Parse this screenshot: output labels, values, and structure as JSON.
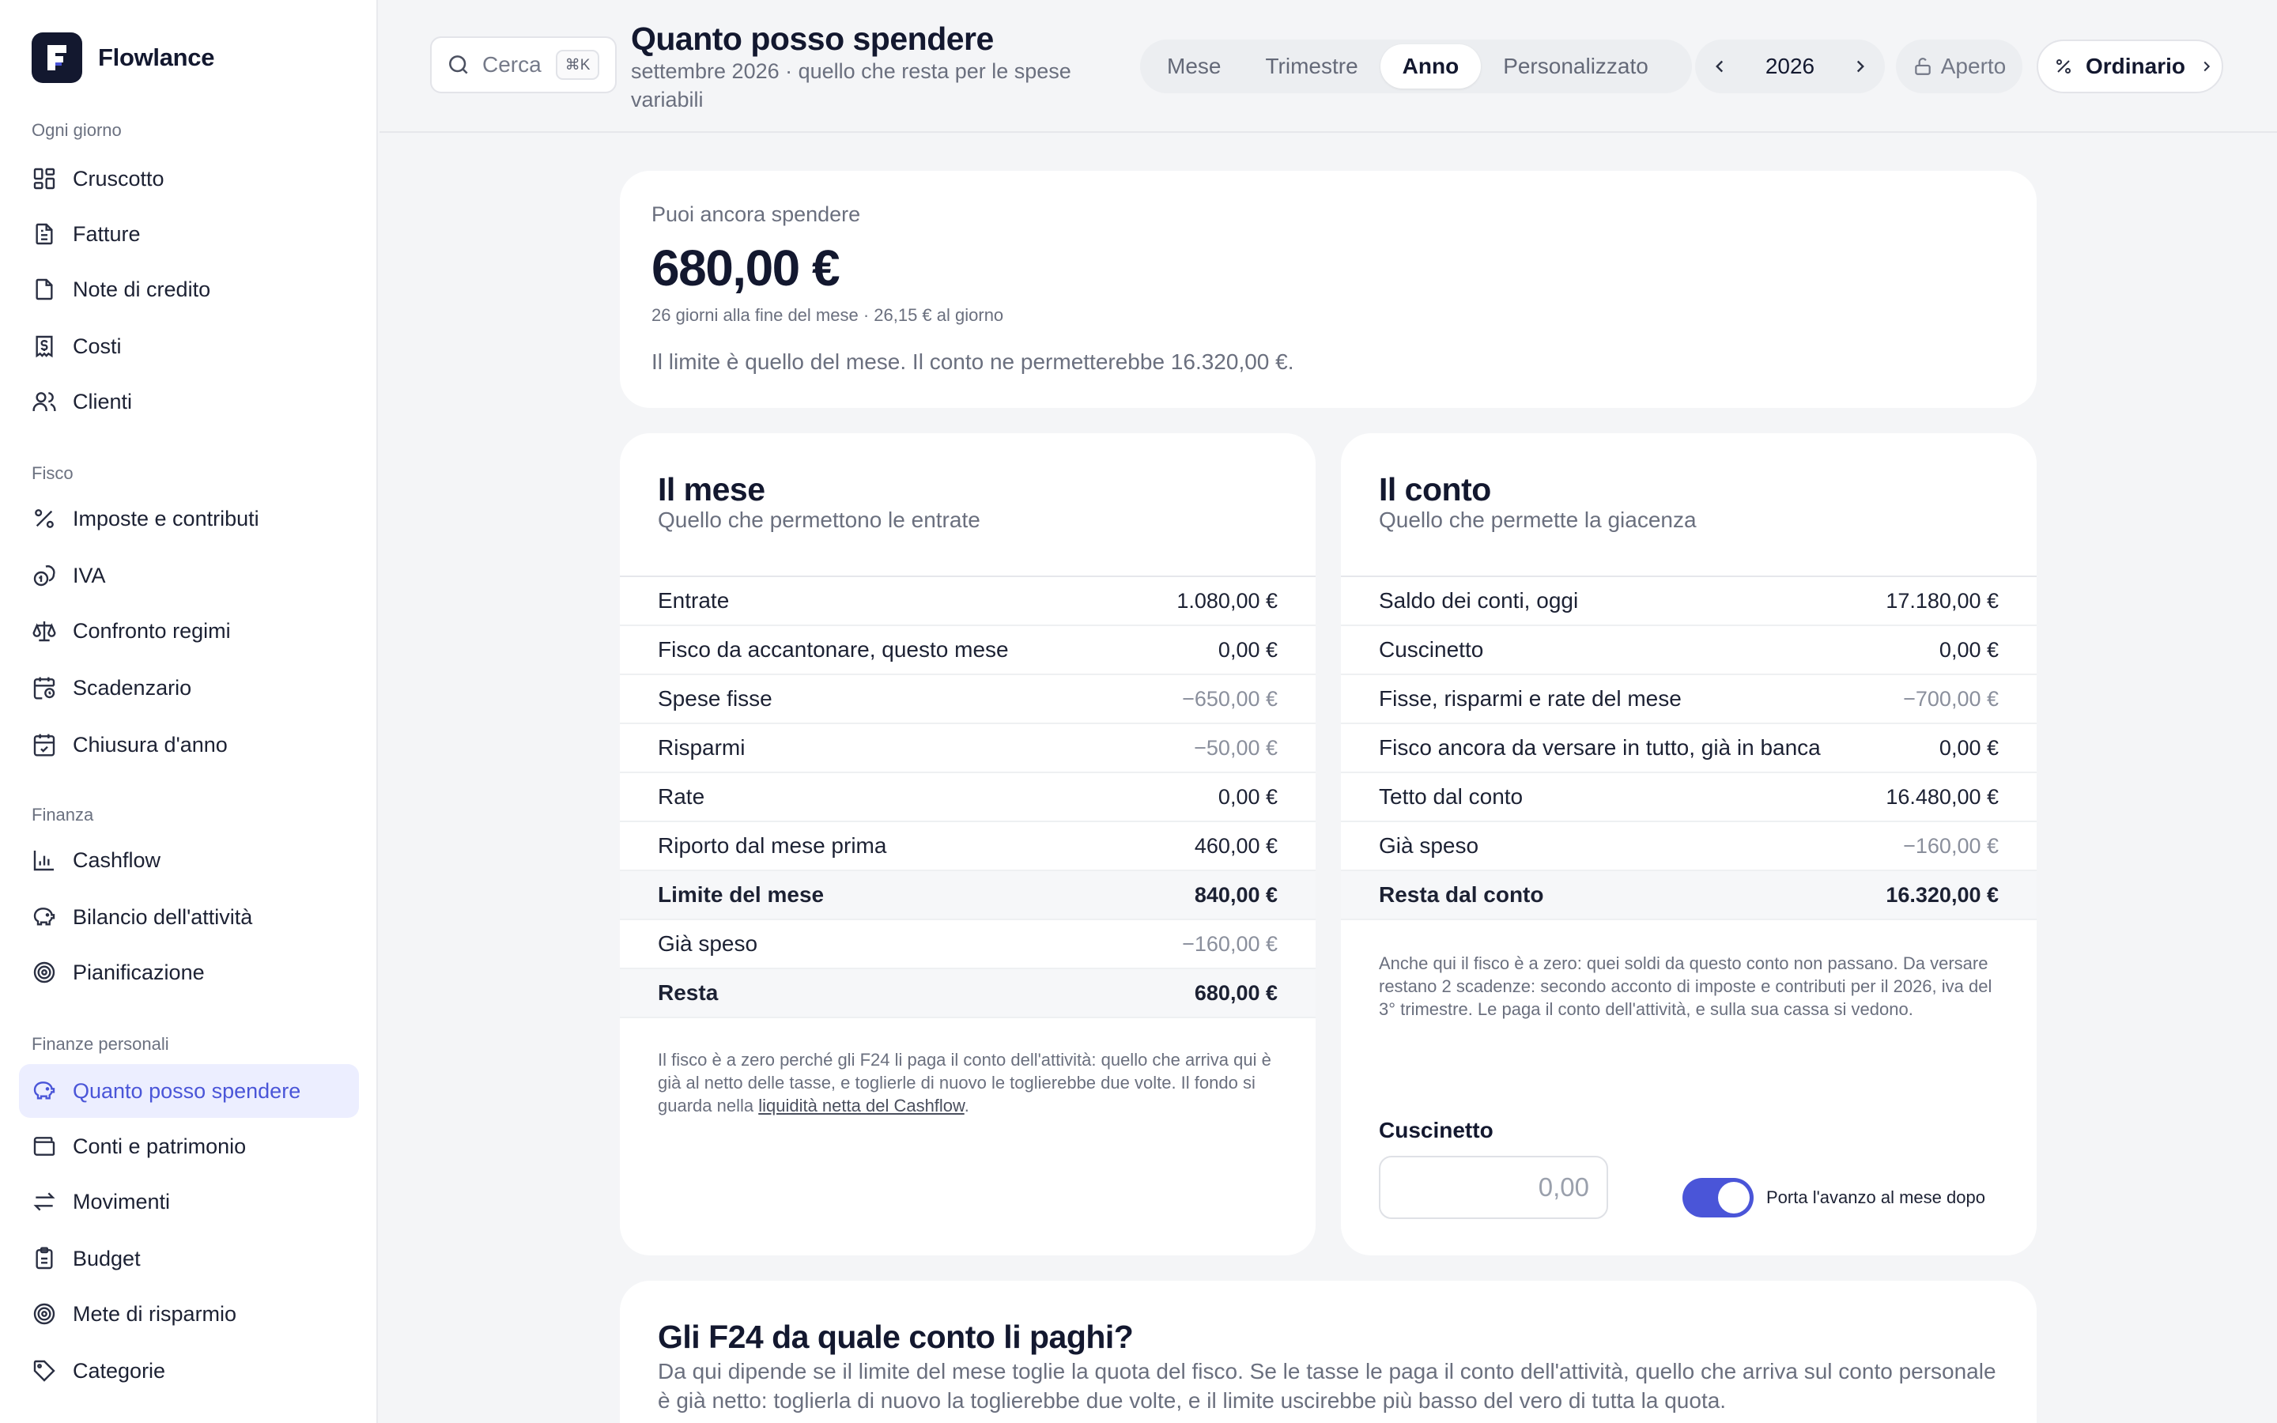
{
  "app": {
    "name": "Flowlance"
  },
  "sidebar": {
    "sections": [
      {
        "title": "Ogni giorno",
        "items": [
          {
            "label": "Cruscotto",
            "icon": "dashboard-icon"
          },
          {
            "label": "Fatture",
            "icon": "invoice-icon"
          },
          {
            "label": "Note di credito",
            "icon": "credit-note-icon"
          },
          {
            "label": "Costi",
            "icon": "receipt-icon"
          },
          {
            "label": "Clienti",
            "icon": "users-icon"
          }
        ]
      },
      {
        "title": "Fisco",
        "items": [
          {
            "label": "Imposte e contributi",
            "icon": "percent-icon"
          },
          {
            "label": "IVA",
            "icon": "coins-icon"
          },
          {
            "label": "Confronto regimi",
            "icon": "scale-icon"
          },
          {
            "label": "Scadenzario",
            "icon": "calendar-clock-icon"
          },
          {
            "label": "Chiusura d'anno",
            "icon": "calendar-check-icon"
          }
        ]
      },
      {
        "title": "Finanza",
        "items": [
          {
            "label": "Cashflow",
            "icon": "bar-chart-icon"
          },
          {
            "label": "Bilancio dell'attività",
            "icon": "piggy-bank-icon"
          },
          {
            "label": "Pianificazione",
            "icon": "target-icon"
          }
        ]
      },
      {
        "title": "Finanze personali",
        "items": [
          {
            "label": "Quanto posso spendere",
            "icon": "piggy-bank-icon",
            "active": true
          },
          {
            "label": "Conti e patrimonio",
            "icon": "wallet-icon"
          },
          {
            "label": "Movimenti",
            "icon": "arrows-swap-icon"
          },
          {
            "label": "Budget",
            "icon": "clipboard-icon"
          },
          {
            "label": "Mete di risparmio",
            "icon": "target-icon"
          },
          {
            "label": "Categorie",
            "icon": "tag-icon"
          }
        ]
      }
    ]
  },
  "topbar": {
    "search_label": "Cerca",
    "search_shortcut": "⌘K",
    "title": "Quanto posso spendere",
    "subtitle": "settembre 2026 · quello che resta per le spese variabili",
    "period_tabs": [
      "Mese",
      "Trimestre",
      "Anno",
      "Personalizzato"
    ],
    "active_period": "Anno",
    "year": "2026",
    "lock_label": "Aperto",
    "regime_label": "Ordinario"
  },
  "summary": {
    "label": "Puoi ancora spendere",
    "amount": "680,00 €",
    "meta": "26 giorni alla fine del mese · 26,15 € al giorno",
    "note": "Il limite è quello del mese. Il conto ne permetterebbe 16.320,00 €."
  },
  "month_card": {
    "title": "Il mese",
    "subtitle": "Quello che permettono le entrate",
    "rows": [
      {
        "label": "Entrate",
        "value": "1.080,00 €"
      },
      {
        "label": "Fisco da accantonare, questo mese",
        "value": "0,00 €"
      },
      {
        "label": "Spese fisse",
        "value": "−650,00 €",
        "negative": true
      },
      {
        "label": "Risparmi",
        "value": "−50,00 €",
        "negative": true
      },
      {
        "label": "Rate",
        "value": "0,00 €"
      },
      {
        "label": "Riporto dal mese prima",
        "value": "460,00 €"
      },
      {
        "label": "Limite del mese",
        "value": "840,00 €",
        "total": true
      },
      {
        "label": "Già speso",
        "value": "−160,00 €",
        "negative": true
      },
      {
        "label": "Resta",
        "value": "680,00 €",
        "total": true
      }
    ],
    "footnote": "Il fisco è a zero perché gli F24 li paga il conto dell'attività: quello che arriva qui è già al netto delle tasse, e toglierle di nuovo le toglierebbe due volte. Il fondo si guarda nella ",
    "footnote_link": "liquidità netta del Cashflow",
    "footnote_end": "."
  },
  "account_card": {
    "title": "Il conto",
    "subtitle": "Quello che permette la giacenza",
    "rows": [
      {
        "label": "Saldo dei conti, oggi",
        "value": "17.180,00 €"
      },
      {
        "label": "Cuscinetto",
        "value": "0,00 €"
      },
      {
        "label": "Fisse, risparmi e rate del mese",
        "value": "−700,00 €",
        "negative": true
      },
      {
        "label": "Fisco ancora da versare in tutto, già in banca",
        "value": "0,00 €"
      },
      {
        "label": "Tetto dal conto",
        "value": "16.480,00 €"
      },
      {
        "label": "Già speso",
        "value": "−160,00 €",
        "negative": true
      },
      {
        "label": "Resta dal conto",
        "value": "16.320,00 €",
        "total": true
      }
    ],
    "footnote": "Anche qui il fisco è a zero: quei soldi da questo conto non passano. Da versare restano 2 scadenze: secondo acconto di imposte e contributi per il 2026, iva del 3° trimestre. Le paga il conto dell'attività, e sulla sua cassa si vedono.",
    "cushion_label": "Cuscinetto",
    "cushion_placeholder": "0,00",
    "carry_over_label": "Porta l'avanzo al mese dopo",
    "carry_over_enabled": true
  },
  "f24_card": {
    "title": "Gli F24 da quale conto li paghi?",
    "body": "Da qui dipende se il limite del mese toglie la quota del fisco. Se le tasse le paga il conto dell'attività, quello che arriva sul conto personale è già netto: toglierla di nuovo la toglierebbe due volte, e il limite uscirebbe più basso del vero di tutta la quota."
  },
  "colors": {
    "accent": "#4a55d8",
    "ink": "#13182f",
    "muted": "#6a6f7e",
    "background": "#f4f5f7"
  }
}
